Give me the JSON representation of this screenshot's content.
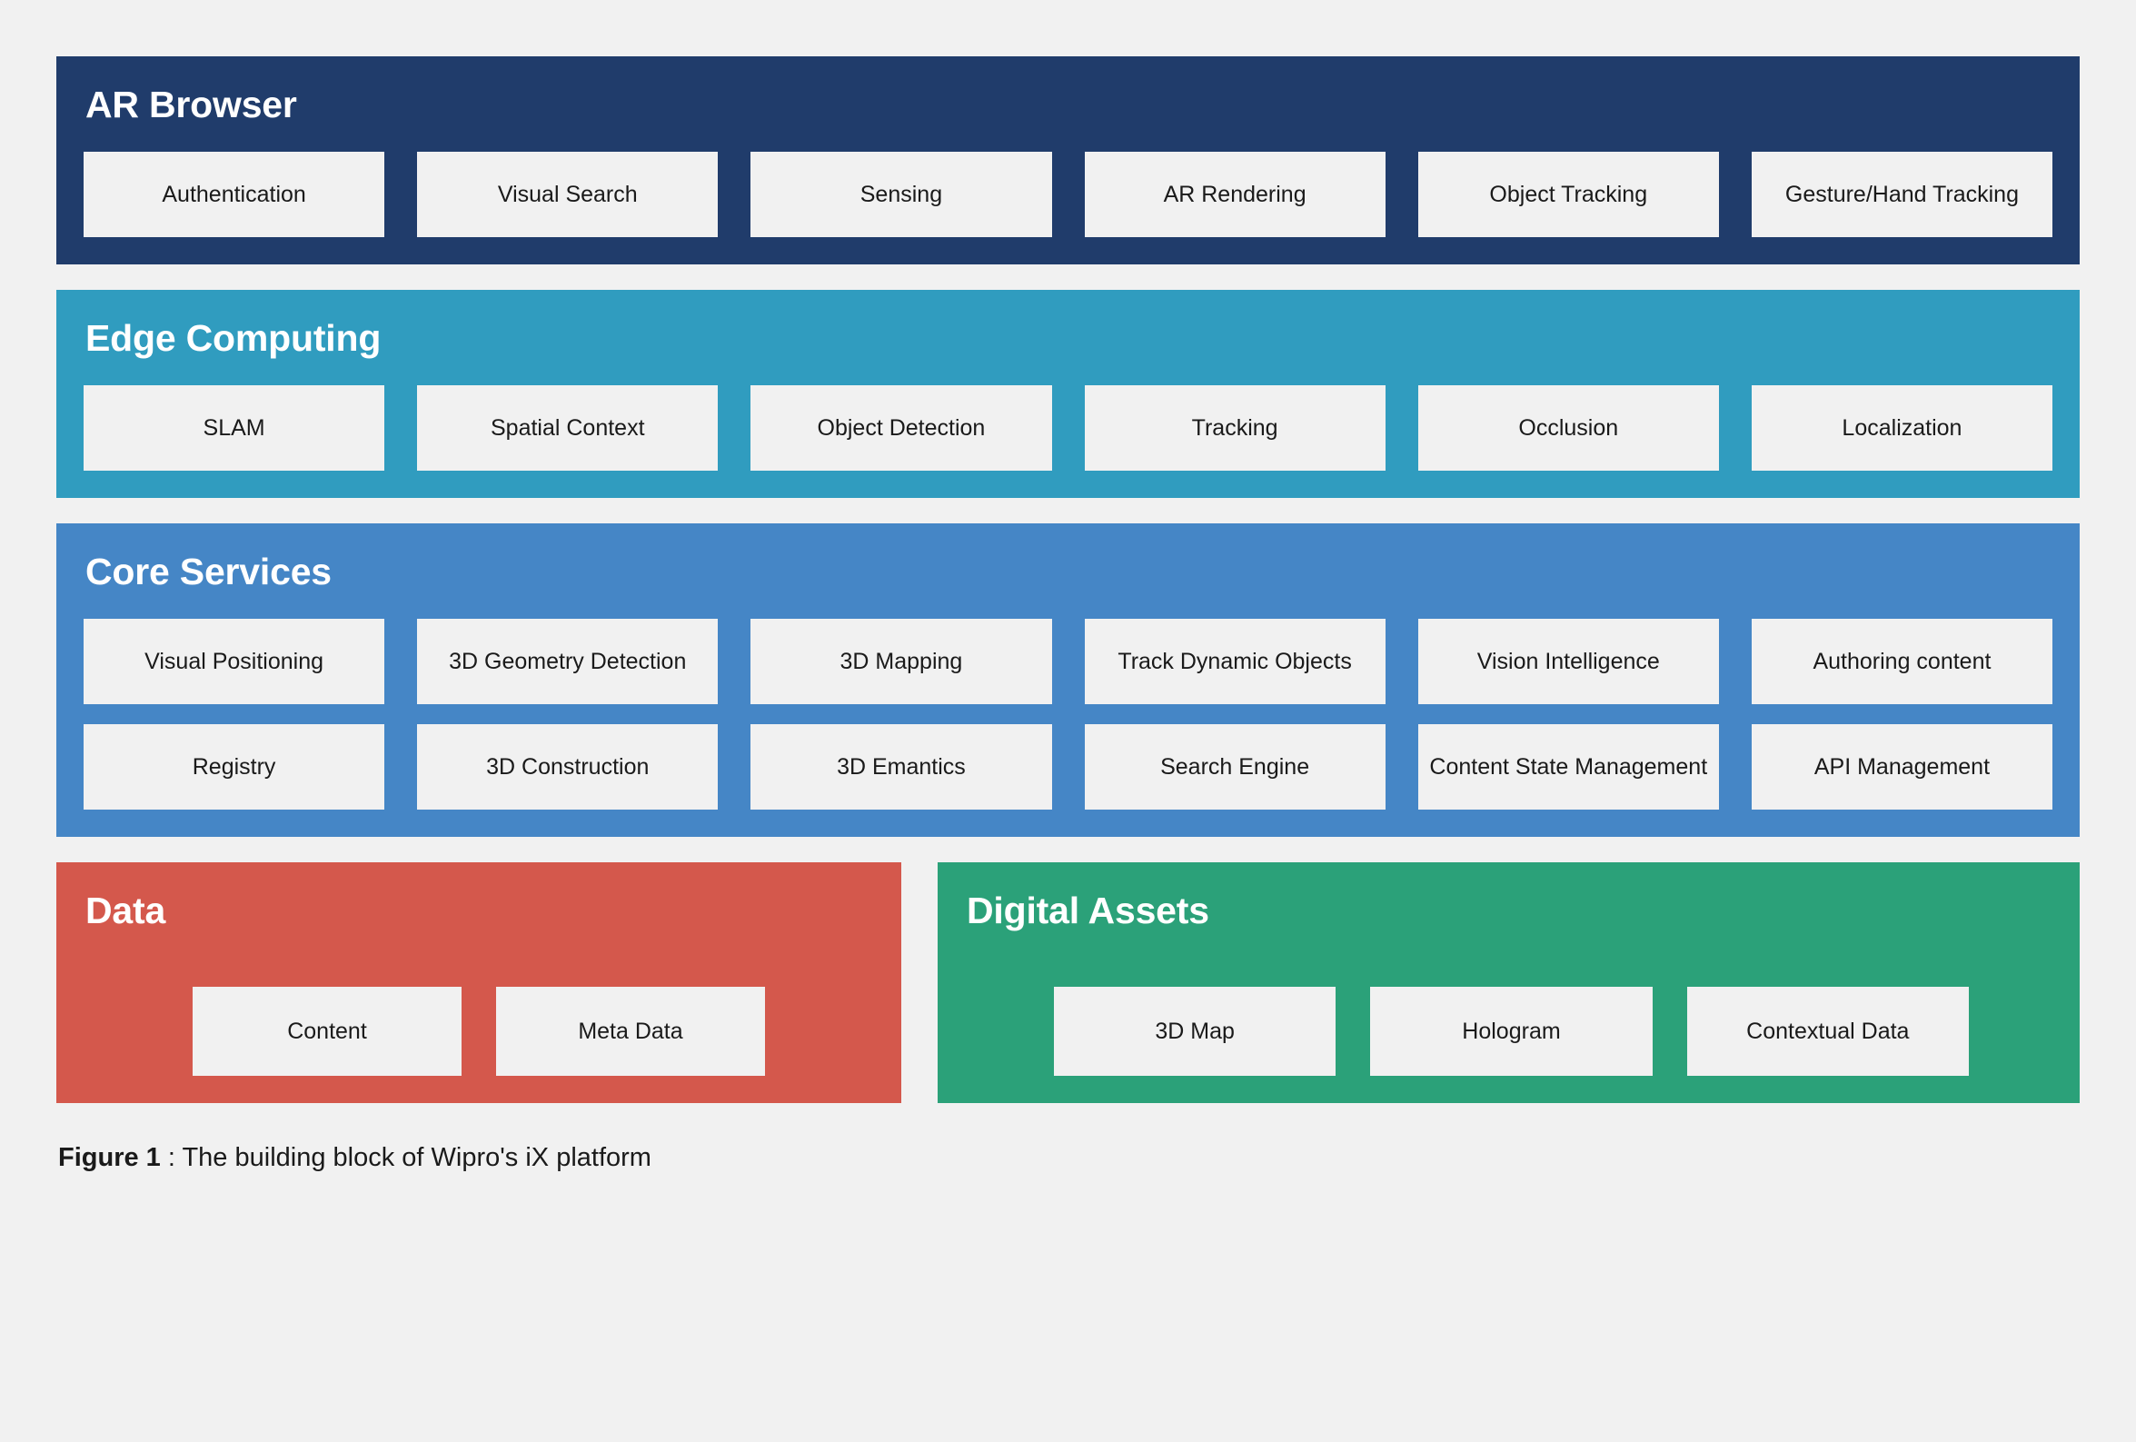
{
  "figure": {
    "caption_label": "Figure 1",
    "caption_separator": " : ",
    "caption_text": "The building block of Wipro's iX platform"
  },
  "colors": {
    "page_background": "#F1F1F1",
    "chip_background": "#F1F1F1",
    "ar_browser": "#203C6B",
    "edge_computing": "#309CBF",
    "core_services": "#4586C6",
    "data": "#D4584C",
    "digital_assets": "#2BA179",
    "title_text": "#FFFFFF",
    "chip_text": "#1A1A1A"
  },
  "layers": {
    "ar_browser": {
      "title": "AR Browser",
      "items": [
        "Authentication",
        "Visual Search",
        "Sensing",
        "AR Rendering",
        "Object Tracking",
        "Gesture/Hand Tracking"
      ]
    },
    "edge_computing": {
      "title": "Edge Computing",
      "items": [
        "SLAM",
        "Spatial Context",
        "Object Detection",
        "Tracking",
        "Occlusion",
        "Localization"
      ]
    },
    "core_services": {
      "title": "Core Services",
      "row1": [
        "Visual Positioning",
        "3D Geometry Detection",
        "3D Mapping",
        "Track Dynamic Objects",
        "Vision Intelligence",
        "Authoring content"
      ],
      "row2": [
        "Registry",
        "3D Construction",
        "3D Emantics",
        "Search Engine",
        "Content State Management",
        "API Management"
      ]
    },
    "data": {
      "title": "Data",
      "items": [
        "Content",
        "Meta Data"
      ]
    },
    "digital_assets": {
      "title": "Digital Assets",
      "items": [
        "3D Map",
        "Hologram",
        "Contextual Data"
      ]
    }
  }
}
